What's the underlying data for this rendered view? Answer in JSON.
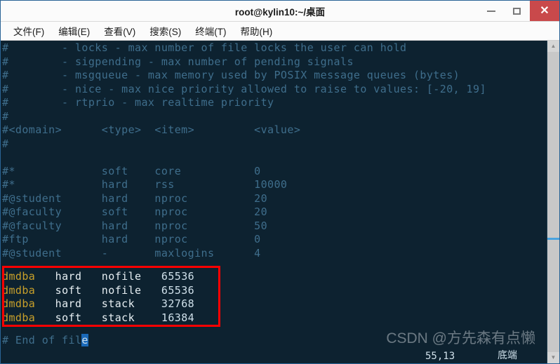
{
  "window": {
    "title": "root@kylin10:~/桌面",
    "controls": {
      "minimize": "−",
      "maximize": "□",
      "close": "✕"
    }
  },
  "menubar": {
    "items": [
      {
        "label": "文件(F)"
      },
      {
        "label": "编辑(E)"
      },
      {
        "label": "查看(V)"
      },
      {
        "label": "搜索(S)"
      },
      {
        "label": "终端(T)"
      },
      {
        "label": "帮助(H)"
      }
    ]
  },
  "terminal": {
    "background_color": "#0d2230",
    "comment_color": "#3f6e8c",
    "user_color": "#c8a02a",
    "value_color": "#cfe0ea",
    "lines": [
      {
        "text": "#        - locks - max number of file locks the user can hold",
        "style": "comment"
      },
      {
        "text": "#        - sigpending - max number of pending signals",
        "style": "comment"
      },
      {
        "text": "#        - msgqueue - max memory used by POSIX message queues (bytes)",
        "style": "comment"
      },
      {
        "text": "#        - nice - max nice priority allowed to raise to values: [-20, 19]",
        "style": "comment"
      },
      {
        "text": "#        - rtprio - max realtime priority",
        "style": "comment"
      },
      {
        "text": "#",
        "style": "comment"
      },
      {
        "text": "#<domain>      <type>  <item>         <value>",
        "style": "comment"
      },
      {
        "text": "#",
        "style": "comment"
      },
      {
        "text": "",
        "style": "comment"
      },
      {
        "text": "#*             soft    core           0",
        "style": "comment"
      },
      {
        "text": "#*             hard    rss            10000",
        "style": "comment"
      },
      {
        "text": "#@student      hard    nproc          20",
        "style": "comment"
      },
      {
        "text": "#@faculty      soft    nproc          20",
        "style": "comment"
      },
      {
        "text": "#@faculty      hard    nproc          50",
        "style": "comment"
      },
      {
        "text": "#ftp           hard    nproc          0",
        "style": "comment"
      },
      {
        "text": "#@student      -       maxlogins      4",
        "style": "comment"
      },
      {
        "text": "",
        "style": "comment"
      }
    ],
    "limit_rows": [
      {
        "domain": "dmdba",
        "type": "hard",
        "item": "nofile",
        "value": "65536"
      },
      {
        "domain": "dmdba",
        "type": "soft",
        "item": "nofile",
        "value": "65536"
      },
      {
        "domain": "dmdba",
        "type": "hard",
        "item": "stack",
        "value": "32768"
      },
      {
        "domain": "dmdba",
        "type": "soft",
        "item": "stack",
        "value": "16384"
      }
    ],
    "end_line": {
      "prefix": "# End of fil",
      "cursor_char": "e"
    },
    "annotation": {
      "shape": "rectangle",
      "color": "#ff0000"
    },
    "watermark": "CSDN @方先森有点懒",
    "status": {
      "position": "55,13",
      "scroll_state": "底端"
    }
  },
  "scrollbar": {
    "up_arrow": "▲",
    "down_arrow": "▼"
  }
}
